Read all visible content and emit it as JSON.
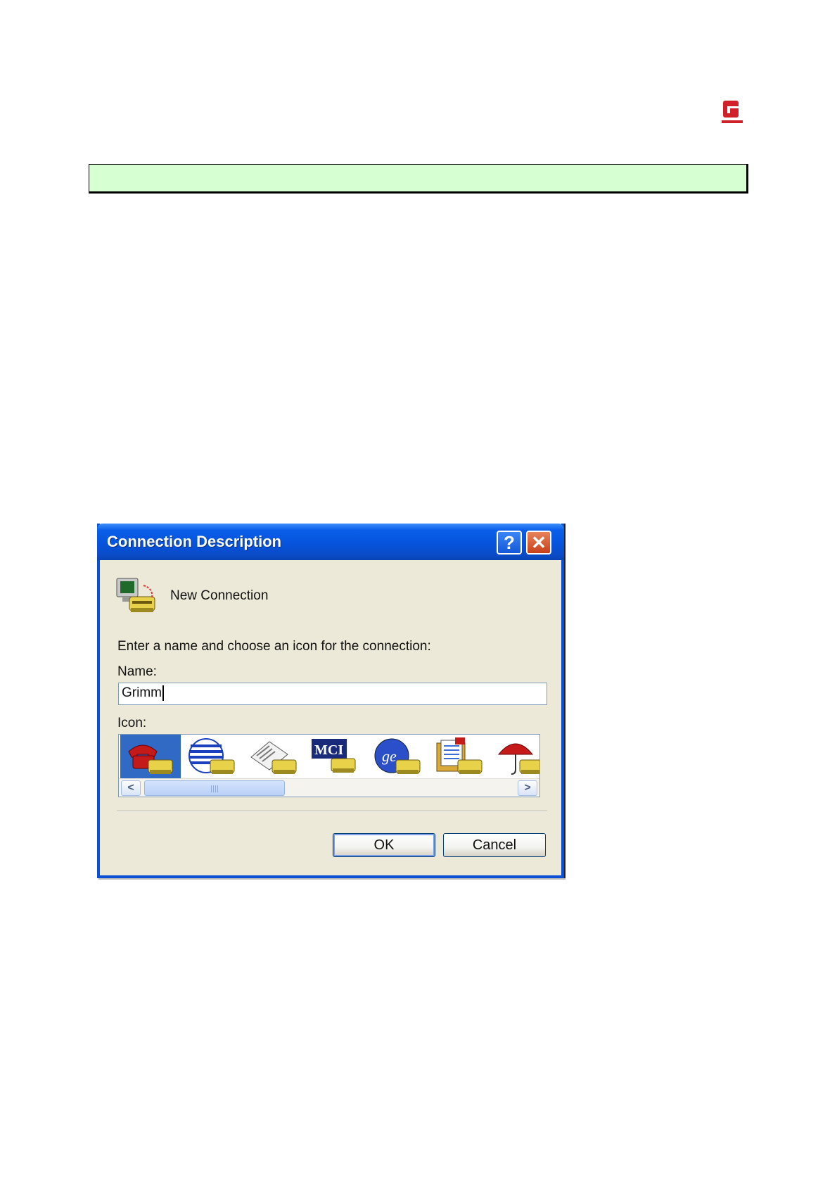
{
  "dialog": {
    "title": "Connection Description",
    "help_symbol": "?",
    "close_symbol": "✕",
    "connection_label": "New Connection",
    "prompt": "Enter a name and choose an icon for the connection:",
    "name_label": "Name:",
    "name_value": "Grimm",
    "icon_label": "Icon:",
    "icons": [
      "red-phone-icon",
      "globe-phone-icon",
      "newspaper-phone-icon",
      "mci-phone-icon",
      "ge-phone-icon",
      "documents-phone-icon",
      "umbrella-phone-icon"
    ],
    "selected_icon_index": 0,
    "scroll_grip": "III",
    "ok_label": "OK",
    "cancel_label": "Cancel"
  },
  "colors": {
    "banner": "#d6ffd2",
    "titlebar": "#0653dc",
    "dialog_face": "#ece9d8",
    "selection": "#316ac5"
  }
}
